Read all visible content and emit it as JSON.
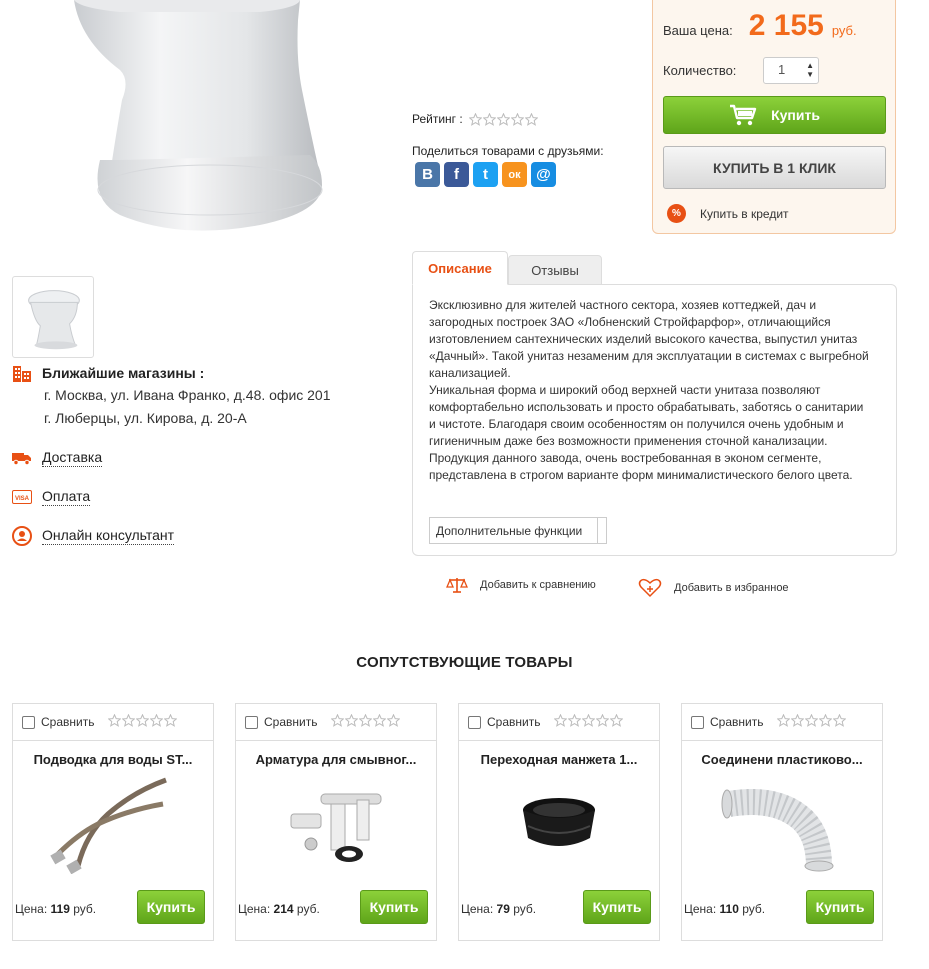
{
  "buy_box": {
    "price_label": "Ваша цена:",
    "price_value": "2 155",
    "price_currency": "руб.",
    "qty_label": "Количество:",
    "qty_value": "1",
    "buy_label": "Купить",
    "oneclick_label": "КУПИТЬ В 1 КЛИК",
    "credit_icon": "%",
    "credit_label": "Купить в кредит"
  },
  "rating": {
    "label": "Рейтинг :",
    "value": 0,
    "max": 5
  },
  "share": {
    "label": "Поделиться товарами с друзьями:",
    "icons": [
      {
        "name": "vk",
        "glyph": "В",
        "color": "#4a76a8"
      },
      {
        "name": "facebook",
        "glyph": "f",
        "color": "#3b5998"
      },
      {
        "name": "twitter",
        "glyph": "t",
        "color": "#1da1f2"
      },
      {
        "name": "odnoklassniki",
        "glyph": "ок",
        "color": "#f7931e"
      },
      {
        "name": "mailru",
        "glyph": "@",
        "color": "#168de2"
      }
    ]
  },
  "stores": {
    "title": "Ближайшие магазины :",
    "addresses": [
      "г. Москва, ул. Ивана Франко, д.48. офис 201",
      "г. Люберцы, ул. Кирова, д. 20-А"
    ]
  },
  "links": {
    "delivery": "Доставка",
    "payment": "Оплата",
    "consultant": "Онлайн консультант"
  },
  "tabs": {
    "description": "Описание",
    "reviews": "Отзывы"
  },
  "description": {
    "p1": "Эксклюзивно для жителей частного сектора, хозяев коттеджей, дач и загородных построек ЗАО «Лобненский Стройфарфор», отличающийся изготовлением сантехнических изделий высокого качества, выпустил унитаз «Дачный». Такой унитаз незаменим для эксплуатации в системах с выгребной канализацией.",
    "p2": "Уникальная форма и широкий обод верхней части унитаза позволяют комфортабельно использовать и просто обрабатывать, заботясь о санитарии и чистоте. Благодаря своим особенностям он получился очень удобным и гигиеничным даже без возможности применения сточной канализации. Продукция данного завода, очень востребованная в эконом сегменте, представлена в строгом варианте форм минималистического белого цвета.",
    "extra_button": "Дополнительные функции"
  },
  "actions": {
    "compare": "Добавить к сравнению",
    "favorite": "Добавить в избранное"
  },
  "related": {
    "title": "СОПУТСТВУЮЩИЕ ТОВАРЫ",
    "compare_label": "Сравнить",
    "price_label": "Цена:",
    "currency": "руб.",
    "buy_label": "Купить",
    "items": [
      {
        "name": "Подводка для воды ST...",
        "price": "119",
        "rating": 0
      },
      {
        "name": "Арматура для смывног...",
        "price": "214",
        "rating": 0
      },
      {
        "name": "Переходная манжета 1...",
        "price": "79",
        "rating": 0
      },
      {
        "name": "Соединени пластиково...",
        "price": "110",
        "rating": 0
      }
    ]
  },
  "colors": {
    "accent": "#f26a1b",
    "buy_green": "#6cb91f",
    "buy_box_bg": "#fdf6ee"
  }
}
